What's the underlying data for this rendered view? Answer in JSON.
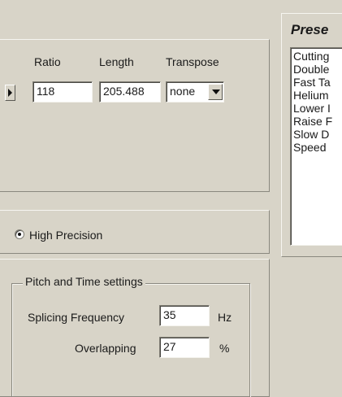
{
  "stretch_panel": {
    "ratio_label": "Ratio",
    "length_label": "Length",
    "transpose_label": "Transpose",
    "ratio_value": "118",
    "length_value": "205.488",
    "transpose_value": "none"
  },
  "precision": {
    "label": "High Precision",
    "selected": true
  },
  "pitch_time": {
    "group_label": "Pitch and Time settings",
    "splicing_label": "Splicing Frequency",
    "splicing_value": "35",
    "splicing_unit": "Hz",
    "overlapping_label": "Overlapping",
    "overlapping_value": "27",
    "overlapping_unit": "%"
  },
  "presets": {
    "title": "Prese",
    "items": [
      "Cutting",
      "Double",
      "Fast Ta",
      "Helium",
      "Lower I",
      "Raise F",
      "Slow D",
      "Speed"
    ]
  }
}
